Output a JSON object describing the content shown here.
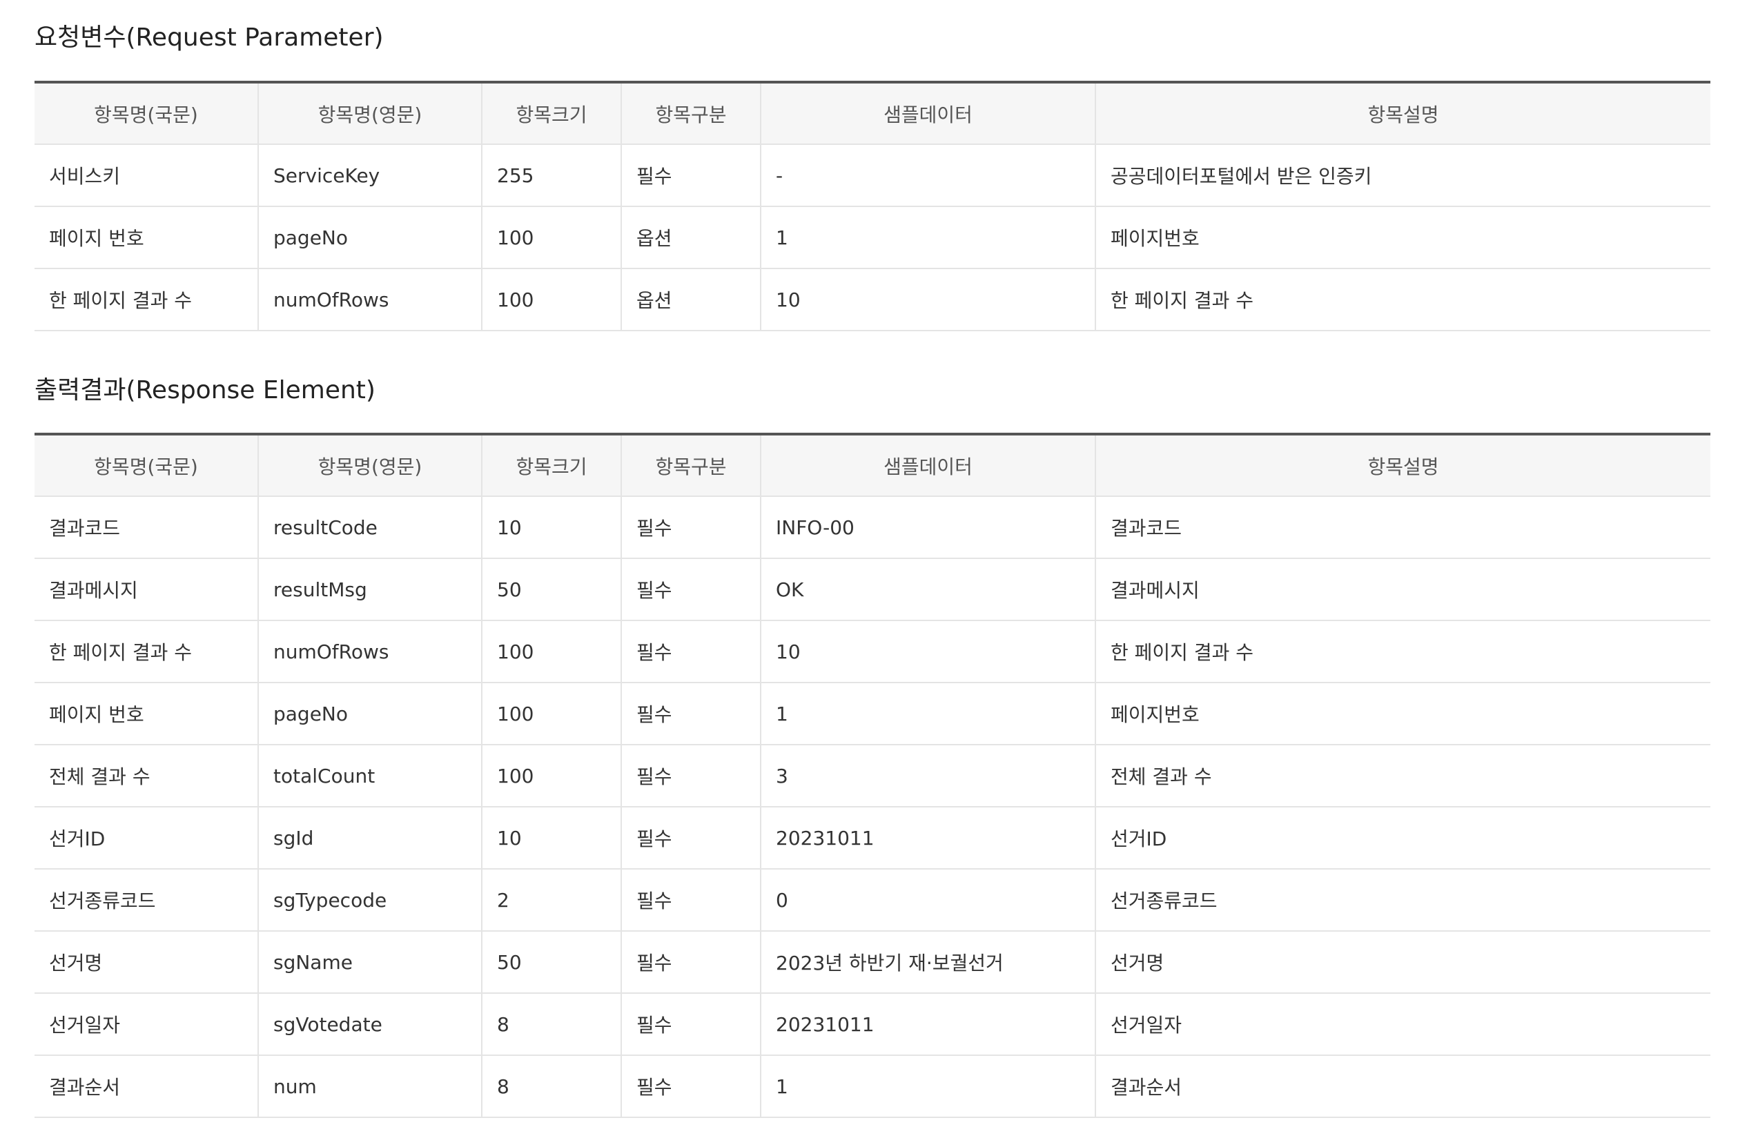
{
  "request": {
    "title": "요청변수(Request Parameter)",
    "columns": [
      "항목명(국문)",
      "항목명(영문)",
      "항목크기",
      "항목구분",
      "샘플데이터",
      "항목설명"
    ],
    "rows": [
      [
        "서비스키",
        "ServiceKey",
        "255",
        "필수",
        "-",
        "공공데이터포털에서 받은 인증키"
      ],
      [
        "페이지 번호",
        "pageNo",
        "100",
        "옵션",
        "1",
        "페이지번호"
      ],
      [
        "한 페이지 결과 수",
        "numOfRows",
        "100",
        "옵션",
        "10",
        "한 페이지 결과 수"
      ]
    ]
  },
  "response": {
    "title": "출력결과(Response Element)",
    "columns": [
      "항목명(국문)",
      "항목명(영문)",
      "항목크기",
      "항목구분",
      "샘플데이터",
      "항목설명"
    ],
    "rows": [
      [
        "결과코드",
        "resultCode",
        "10",
        "필수",
        "INFO-00",
        "결과코드"
      ],
      [
        "결과메시지",
        "resultMsg",
        "50",
        "필수",
        "OK",
        "결과메시지"
      ],
      [
        "한 페이지 결과 수",
        "numOfRows",
        "100",
        "필수",
        "10",
        "한 페이지 결과 수"
      ],
      [
        "페이지 번호",
        "pageNo",
        "100",
        "필수",
        "1",
        "페이지번호"
      ],
      [
        "전체 결과 수",
        "totalCount",
        "100",
        "필수",
        "3",
        "전체 결과 수"
      ],
      [
        "선거ID",
        "sgId",
        "10",
        "필수",
        "20231011",
        "선거ID"
      ],
      [
        "선거종류코드",
        "sgTypecode",
        "2",
        "필수",
        "0",
        "선거종류코드"
      ],
      [
        "선거명",
        "sgName",
        "50",
        "필수",
        "2023년 하반기 재·보궐선거",
        "선거명"
      ],
      [
        "선거일자",
        "sgVotedate",
        "8",
        "필수",
        "20231011",
        "선거일자"
      ],
      [
        "결과순서",
        "num",
        "8",
        "필수",
        "1",
        "결과순서"
      ]
    ]
  }
}
